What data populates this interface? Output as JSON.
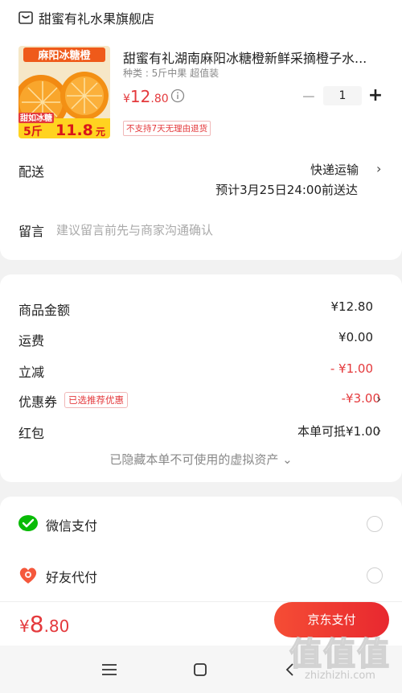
{
  "shop": {
    "name": "甜蜜有礼水果旗舰店",
    "icon": "store-icon"
  },
  "product": {
    "title": "甜蜜有礼湖南麻阳冰糖橙新鲜采摘橙子水...",
    "spec": "种类 : 5斤中果  超值装",
    "price_currency": "¥",
    "price_int": "12",
    "price_dec": ".80",
    "quantity": "1",
    "minus": "−",
    "plus": "+",
    "return_tag": "不支持7天无理由退货",
    "image": {
      "banner": "麻阳冰糖橙",
      "sticker": "甜如冰糖",
      "promo_qty": "5斤",
      "promo_price": "11.8",
      "promo_unit": "元"
    }
  },
  "delivery": {
    "label": "配送",
    "method": "快递运输",
    "eta": "预计3月25日24:00前送达"
  },
  "note": {
    "label": "留言",
    "placeholder": "建议留言前先与商家沟通确认"
  },
  "summary": {
    "rows": [
      {
        "label": "商品金额",
        "value": "¥12.80"
      },
      {
        "label": "运费",
        "value": "¥0.00"
      },
      {
        "label": "立减",
        "value": "- ¥1.00"
      },
      {
        "label": "优惠券",
        "tag": "已选推荐优惠",
        "value": "-¥3.00"
      },
      {
        "label": "红包",
        "value": "本单可抵¥1.00"
      }
    ],
    "hidden_note": "已隐藏本单不可使用的虚拟资产 ⌄"
  },
  "payment_methods": [
    {
      "label": "微信支付",
      "icon": "wechat-pay-icon"
    },
    {
      "label": "好友代付",
      "icon": "friend-pay-icon"
    }
  ],
  "checkout": {
    "currency": "¥",
    "total_int": "8",
    "total_dec": ".80",
    "button": "京东支付"
  },
  "watermark": {
    "brand": "值值值",
    "url": "zhizhizhi.com"
  },
  "colors": {
    "accent": "#e4393c",
    "wechat": "#09bb07",
    "button_start": "#f54d35",
    "button_end": "#e8282f"
  }
}
